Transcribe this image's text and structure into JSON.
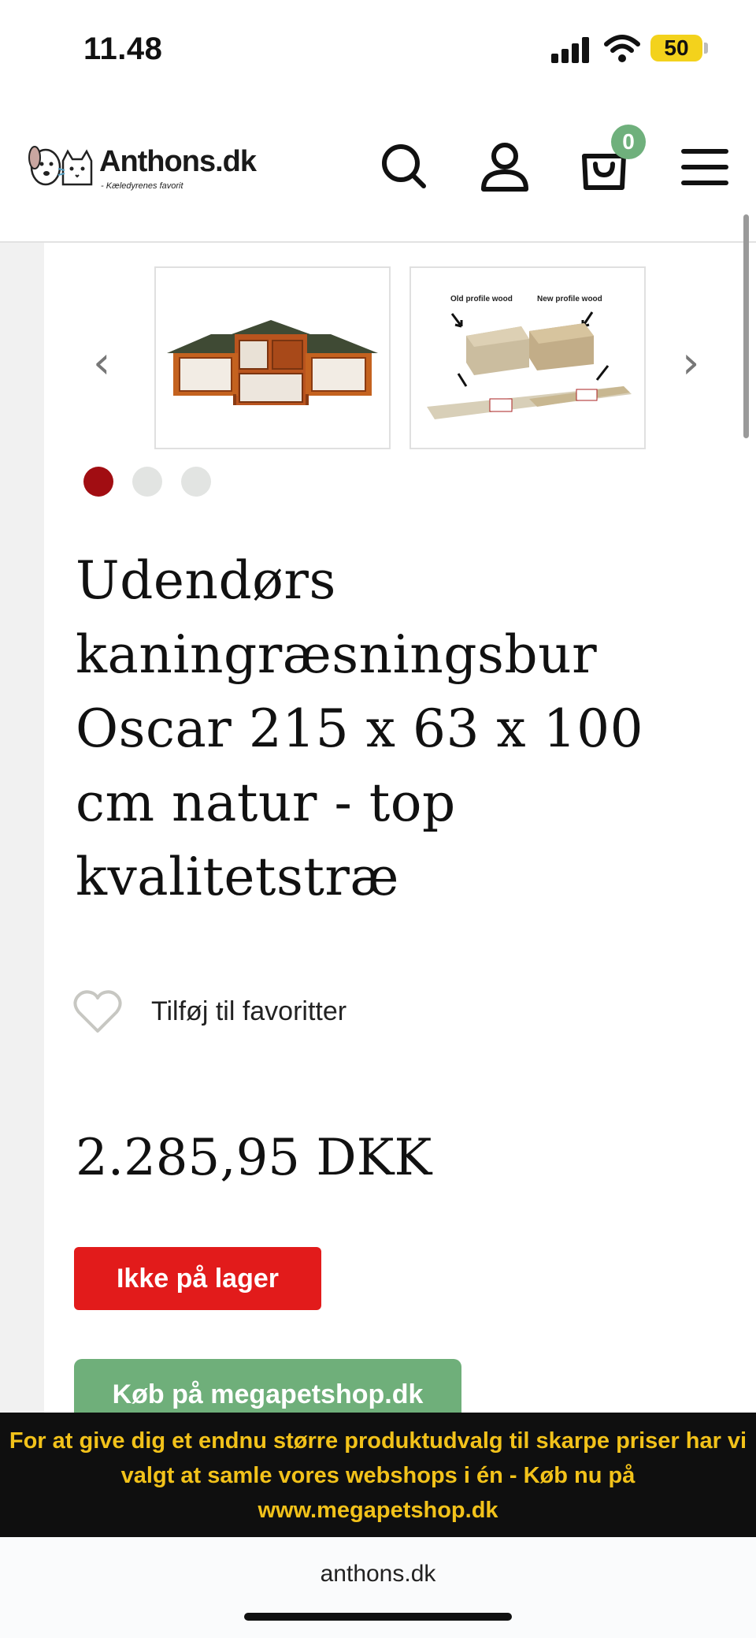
{
  "status_bar": {
    "time": "11.48",
    "battery": "50"
  },
  "header": {
    "logo_text": "Anthons.dk",
    "logo_tagline": "- Kæledyrenes favorit",
    "search_icon": "search-icon",
    "account_icon": "user-icon",
    "cart_icon": "cart-icon",
    "cart_count": "0",
    "menu_icon": "hamburger-icon",
    "badge_color": "#6fb07c"
  },
  "gallery": {
    "prev_arrow": "‹",
    "next_arrow": "›",
    "thumb_labels": [
      "Old profile wood",
      "New profile wood"
    ],
    "dots": 3,
    "active_dot": 0,
    "active_color": "#a10d12"
  },
  "product": {
    "title": "Udendørs kaningræsningsbur Oscar 215 x 63 x 100 cm natur - top kvalitetstræ",
    "favorite_label": "Tilføj til favoritter",
    "price": "2.285,95 DKK",
    "stock_status": "Ikke på lager",
    "buy_button": "Køb på megapetshop.dk"
  },
  "banner": {
    "text": "For at give dig et endnu større produktudvalg til skarpe priser har vi valgt at samle vores webshops i én - Køb nu på www.megapetshop.dk",
    "bg_color": "#0f0f0f",
    "text_color": "#f2c21a"
  },
  "browser": {
    "url": "anthons.dk"
  }
}
